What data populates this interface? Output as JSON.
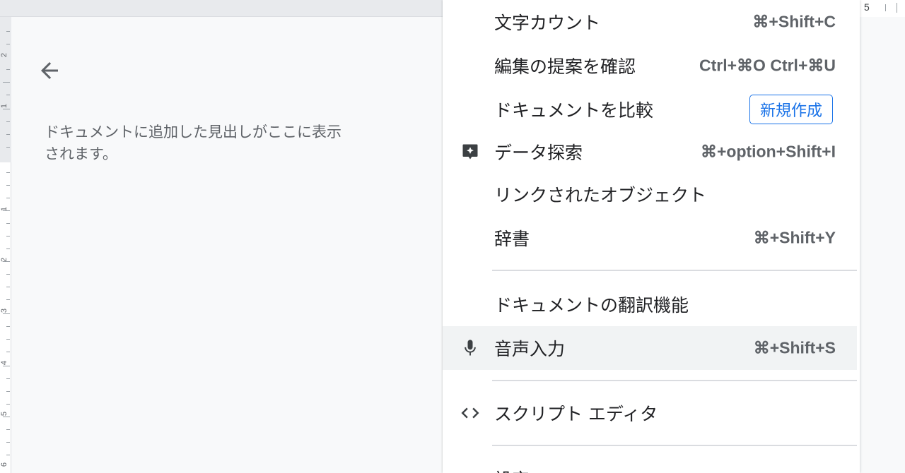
{
  "ruler": {
    "top_number": "5",
    "left_numbers": [
      "2",
      "1",
      "1",
      "2",
      "3",
      "4",
      "5",
      "6"
    ]
  },
  "outline": {
    "hint": "ドキュメントに追加した見出しがここに表示されます。"
  },
  "menu": {
    "items": [
      {
        "label": "文字カウント",
        "shortcut": "⌘+Shift+C"
      },
      {
        "label": "編集の提案を確認",
        "shortcut": "Ctrl+⌘O Ctrl+⌘U"
      },
      {
        "label": "ドキュメントを比較",
        "badge": "新規作成"
      },
      {
        "label": "データ探索",
        "shortcut": "⌘+option+Shift+I",
        "icon": "explore-icon"
      },
      {
        "label": "リンクされたオブジェクト"
      },
      {
        "label": "辞書",
        "shortcut": "⌘+Shift+Y"
      },
      {
        "label": "ドキュメントの翻訳機能"
      },
      {
        "label": "音声入力",
        "shortcut": "⌘+Shift+S",
        "icon": "microphone-icon"
      },
      {
        "label": "スクリプト エディタ",
        "icon": "code-icon"
      },
      {
        "label": "設定"
      }
    ]
  },
  "colors": {
    "accent": "#1a73e8",
    "highlight": "#f1f3f4",
    "divider": "#dadce0"
  }
}
